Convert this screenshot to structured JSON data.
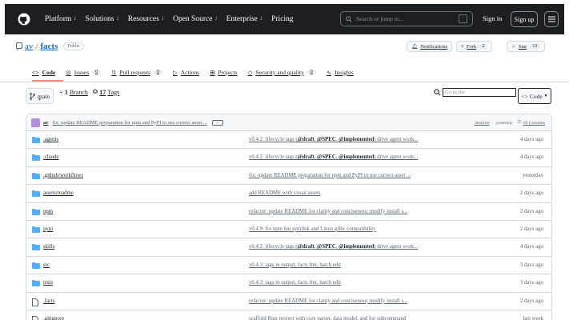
{
  "topbar": {
    "nav": [
      {
        "label": "Platform",
        "chevron": true
      },
      {
        "label": "Solutions",
        "chevron": true
      },
      {
        "label": "Resources",
        "chevron": true
      },
      {
        "label": "Open Source",
        "chevron": true
      },
      {
        "label": "Enterprise",
        "chevron": true
      },
      {
        "label": "Pricing",
        "chevron": false
      }
    ],
    "search_placeholder": "Search or jump to...",
    "search_shortcut": "/",
    "sign_in": "Sign in",
    "sign_up": "Sign up"
  },
  "repo": {
    "owner": "av",
    "separator": "/",
    "name": "facts",
    "visibility": "Public",
    "notifications_label": "Notifications",
    "fork_label": "Fork",
    "fork_count": "2",
    "star_label": "Star",
    "star_count": "13"
  },
  "tabs": [
    {
      "label": "Code",
      "icon": "code-icon",
      "count": null,
      "active": true
    },
    {
      "label": "Issues",
      "icon": "issue-icon",
      "count": "0",
      "active": false
    },
    {
      "label": "Pull requests",
      "icon": "pull-request-icon",
      "count": "0",
      "active": false
    },
    {
      "label": "Actions",
      "icon": "play-icon",
      "count": null,
      "active": false
    },
    {
      "label": "Projects",
      "icon": "table-icon",
      "count": null,
      "active": false
    },
    {
      "label": "Security and quality",
      "icon": "shield-icon",
      "count": "0",
      "active": false
    },
    {
      "label": "Insights",
      "icon": "graph-icon",
      "count": null,
      "active": false
    }
  ],
  "toolbar": {
    "branch": "main",
    "branches_count": "1",
    "branches_label": "Branch",
    "tags_count": "17",
    "tags_label": "Tags",
    "goto_placeholder": "Go to file",
    "code_label": "Code"
  },
  "latest_commit": {
    "author": "av",
    "message": "fix: update README preparation for npm and PyPI to use correct asset ...",
    "ellipsis": "...",
    "hash": "3eab1bd",
    "dot": "·",
    "when": "yesterday",
    "commits_label": "69 Commits"
  },
  "files": [
    {
      "name": ".agents",
      "type": "folder",
      "msg_pre": "v0.4.2: lifecycle tags (",
      "b1": "@draft",
      "mid1": ", ",
      "b2": "@SPEC",
      "mid2": ", ",
      "b3": "@implemented",
      "msg_post": ") drive agent work...",
      "date": "4 days ago"
    },
    {
      "name": ".claude",
      "type": "folder",
      "msg_pre": "v0.4.2: lifecycle tags (",
      "b1": "@draft",
      "mid1": ", ",
      "b2": "@SPEC",
      "mid2": ", ",
      "b3": "@implemented",
      "msg_post": ") drive agent work...",
      "date": "4 days ago"
    },
    {
      "name": ".github/workflows",
      "type": "folder",
      "msg": "fix: update README preparation for npm and PyPI to use correct asset ...",
      "date": "yesterday"
    },
    {
      "name": "assets/readme",
      "type": "folder",
      "msg": "add README with visual assets",
      "date": "2 days ago"
    },
    {
      "name": "npm",
      "type": "folder",
      "msg": "refactor: update README for clarity and conciseness; modify install s...",
      "date": "2 days ago"
    },
    {
      "name": "pypi",
      "type": "folder",
      "msg": "v0.4.9: fix npm bin symlink and Linux glibc compatibility",
      "date": "2 days ago"
    },
    {
      "name": "skills",
      "type": "folder",
      "msg_pre": "v0.4.2: lifecycle tags (",
      "b1": "@draft",
      "mid1": ", ",
      "b2": "@SPEC",
      "mid2": ", ",
      "b3": "@implemented",
      "msg_post": ") drive agent work...",
      "date": "4 days ago"
    },
    {
      "name": "src",
      "type": "folder",
      "msg": "v0.4.3: tags in output, facts fmt, batch edit",
      "date": "3 days ago"
    },
    {
      "name": "tests",
      "type": "folder",
      "msg": "v0.4.3: tags in output, facts fmt, batch edit",
      "date": "3 days ago"
    },
    {
      "name": ".facts",
      "type": "file",
      "msg": "refactor: update README for clarity and conciseness; modify install s...",
      "date": "2 days ago"
    },
    {
      "name": ".gitignore",
      "type": "file",
      "msg": "scaffold Rust project with core parser, data model, and list subcommand",
      "date": "last week"
    }
  ],
  "colors": {
    "topbar_bg": "#1c1e22",
    "link_blue": "#0969da",
    "folder_blue": "#54aeff",
    "tab_underline": "#fd8c73"
  }
}
